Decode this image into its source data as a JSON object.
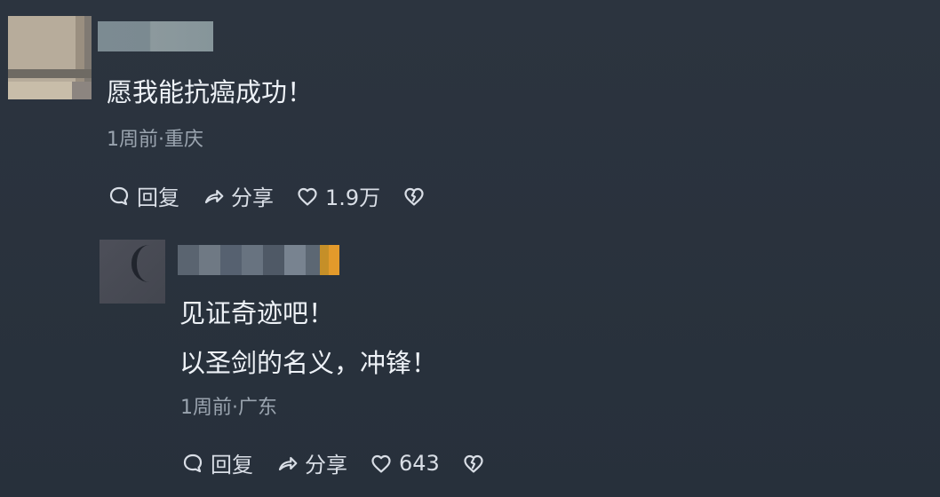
{
  "comments": [
    {
      "avatar": "blurred-user-avatar",
      "name_blurred": true,
      "text": "愿我能抗癌成功！",
      "meta": "1周前·重庆",
      "actions": {
        "reply_label": "回复",
        "share_label": "分享",
        "like_count": "1.9万"
      }
    },
    {
      "avatar": "blurred-user-avatar",
      "name_blurred": true,
      "text_lines": [
        "见证奇迹吧！",
        "以圣剑的名义，冲锋！"
      ],
      "meta": "1周前·广东",
      "actions": {
        "reply_label": "回复",
        "share_label": "分享",
        "like_count": "643"
      }
    }
  ],
  "icons": {
    "reply": "comment-bubble-icon",
    "share": "share-arrow-icon",
    "like": "heart-icon",
    "dislike": "broken-heart-icon"
  },
  "colors": {
    "background": "#2a323d",
    "primary_text": "#eef2f7",
    "secondary_text": "#9aa4af",
    "action_text": "#d9dee6"
  }
}
